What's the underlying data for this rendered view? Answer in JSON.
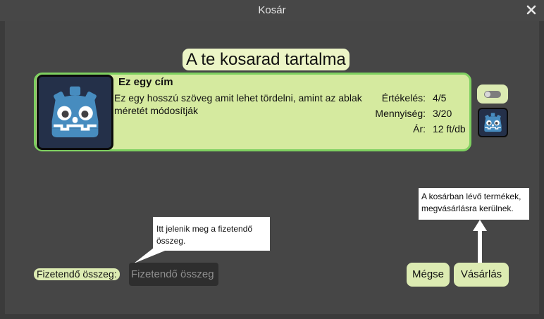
{
  "window": {
    "title": "Kosár"
  },
  "heading": "A te kosarad tartalma",
  "item": {
    "title": "Ez egy cím",
    "description": "Ez egy hosszú szöveg amit lehet tördelni, amint az ablak méretét módosítják",
    "rating_label": "Értékelés:",
    "rating_value": "4/5",
    "quantity_label": "Mennyiség:",
    "quantity_value": "3/20",
    "price_label": "Ár:",
    "price_value": "12 ft/db",
    "icon": "godot-robot-icon"
  },
  "tooltips": {
    "amount": "Itt jelenik meg a fizetendő összeg.",
    "purchase": "A kosárban lévő termékek, megvásárlásra kerülnek."
  },
  "footer": {
    "sum_label": "Fizetendő összeg:",
    "sum_placeholder": "Fizetendő összeg",
    "cancel_label": "Mégse",
    "buy_label": "Vásárlás"
  },
  "colors": {
    "card_bg": "#d5ea9f",
    "card_border": "#7ed060",
    "button_bg": "#dcebb2",
    "logo_blue": "#478cbf"
  }
}
